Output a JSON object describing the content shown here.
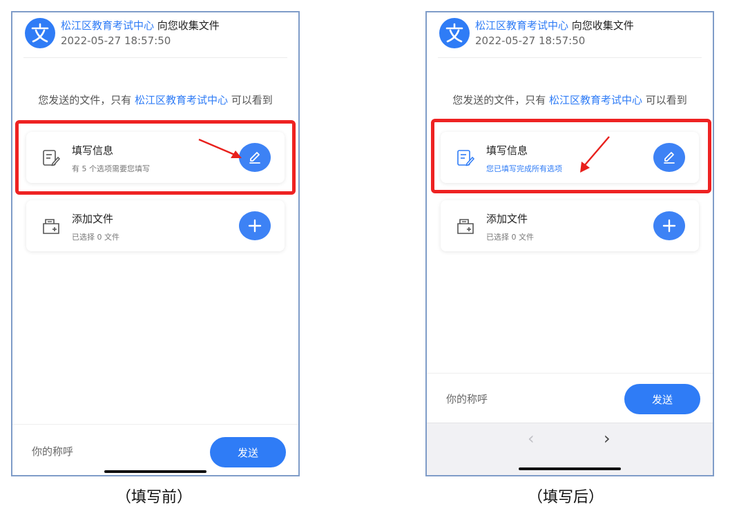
{
  "left_phone": {
    "header": {
      "org_name": "松江区教育考试中心",
      "title_suffix": " 向您收集文件",
      "timestamp": "2022-05-27 18:57:50"
    },
    "notice": {
      "prefix": "您发送的文件，只有 ",
      "org_name": "松江区教育考试中心",
      "suffix": " 可以看到"
    },
    "fill_card": {
      "title": "填写信息",
      "subtitle": "有 5 个选项需要您填写"
    },
    "file_card": {
      "title": "添加文件",
      "subtitle": "已选择 0 文件"
    },
    "bottom": {
      "nickname_placeholder": "你的称呼",
      "send_label": "发送"
    }
  },
  "right_phone": {
    "header": {
      "org_name": "松江区教育考试中心",
      "title_suffix": " 向您收集文件",
      "timestamp": "2022-05-27 18:57:50"
    },
    "notice": {
      "prefix": "您发送的文件，只有 ",
      "org_name": "松江区教育考试中心",
      "suffix": " 可以看到"
    },
    "fill_card": {
      "title": "填写信息",
      "subtitle": "您已填写完成所有选项"
    },
    "file_card": {
      "title": "添加文件",
      "subtitle": "已选择 0 文件"
    },
    "bottom": {
      "nickname_placeholder": "你的称呼",
      "send_label": "发送"
    },
    "browser_nav": {
      "back_glyph": "‹",
      "forward_glyph": "›"
    }
  },
  "captions": {
    "before": "（填写前）",
    "after": "（填写后）"
  },
  "icons": {
    "logo": "translate-wen-icon",
    "fill": "form-edit-icon",
    "file": "folder-add-icon",
    "edit_button": "pencil-icon",
    "add_button": "plus-icon"
  },
  "colors": {
    "accent": "#2f7cf6",
    "highlight": "#ee2222",
    "annotation_arrow": "#e8201c"
  }
}
